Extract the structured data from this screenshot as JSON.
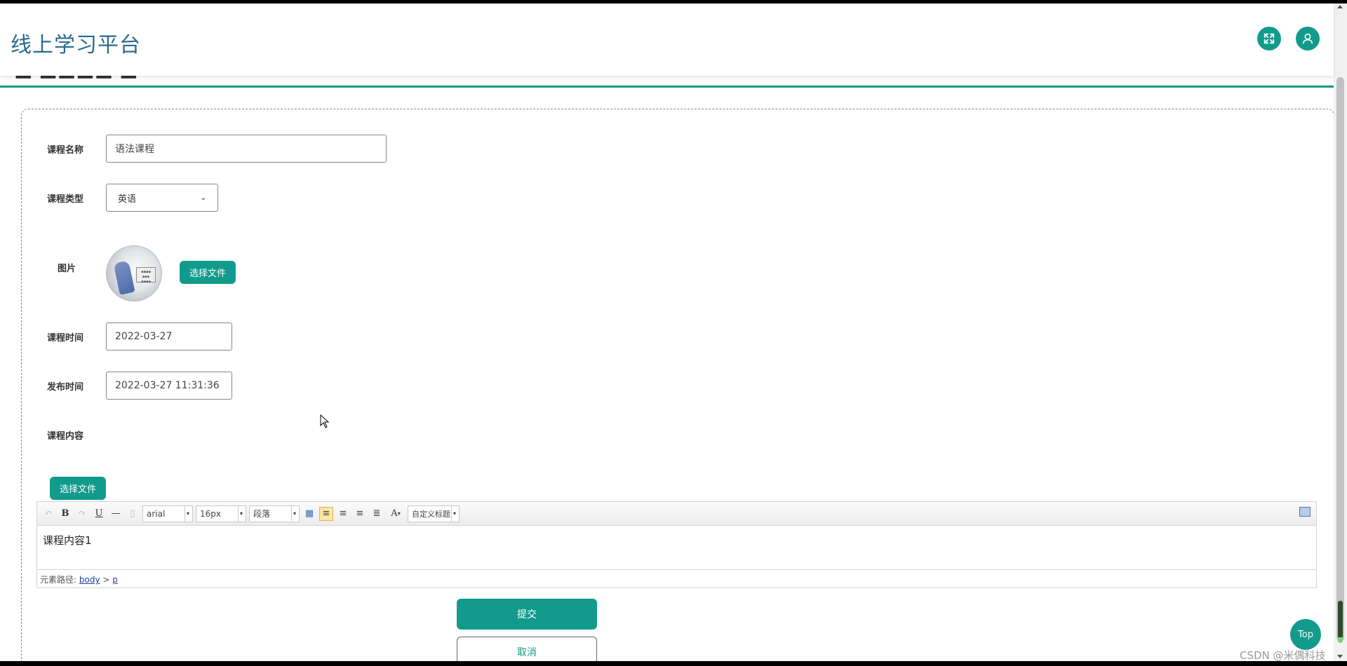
{
  "header": {
    "brand": "线上学习平台",
    "fullscreen_icon": "expand-icon",
    "user_icon": "user-icon"
  },
  "form": {
    "course_name": {
      "label": "课程名称",
      "value": "语法课程"
    },
    "course_type": {
      "label": "课程类型",
      "value": "英语"
    },
    "image": {
      "label": "图片",
      "choose_label": "选择文件"
    },
    "course_time": {
      "label": "课程时间",
      "value": "2022-03-27"
    },
    "publish_time": {
      "label": "发布时间",
      "value": "2022-03-27 11:31:36"
    },
    "course_content": {
      "label": "课程内容",
      "choose_label": "选择文件"
    }
  },
  "editor": {
    "font_family": "arial",
    "font_size": "16px",
    "paragraph": "段落",
    "custom_heading": "自定义标题",
    "content": "课程内容1",
    "path_label": "元素路径:",
    "path_body": "body",
    "path_sep": ">",
    "path_p": "p"
  },
  "actions": {
    "submit": "提交",
    "cancel": "取消",
    "top": "Top"
  },
  "watermark": "CSDN @米偶科技",
  "colors": {
    "accent": "#129b8c",
    "brand_text": "#2a6b8f"
  }
}
